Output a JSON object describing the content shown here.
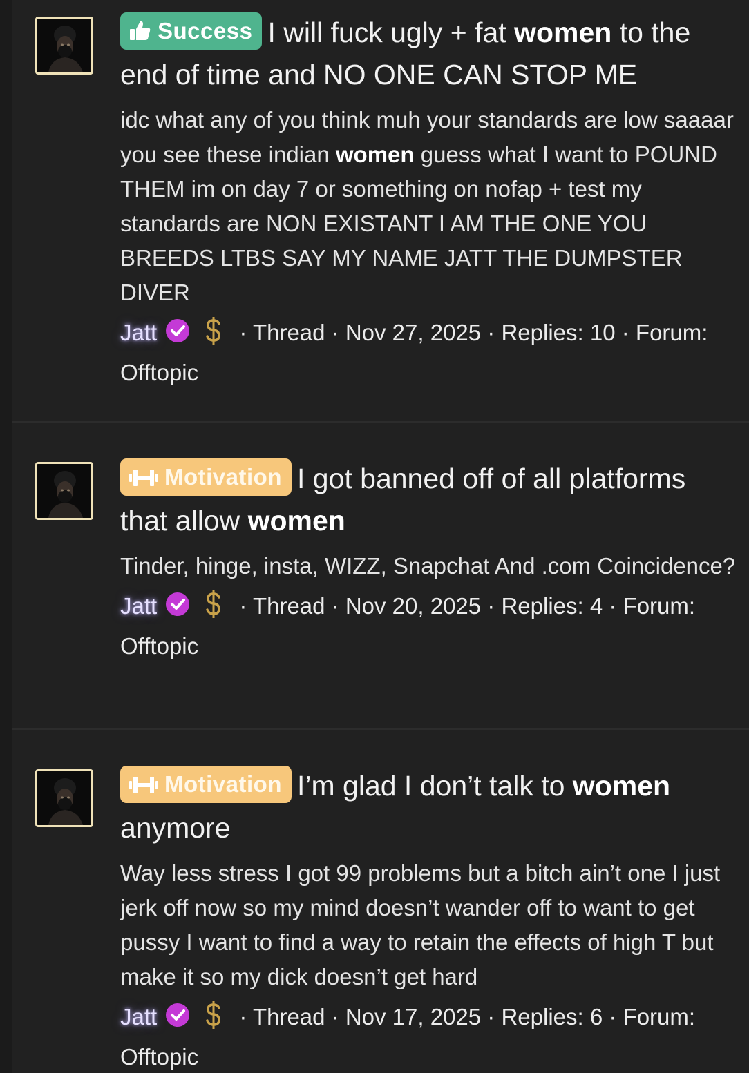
{
  "colors": {
    "background": "#212121",
    "success_prefix": "#4fb48e",
    "motivation_prefix": "#f7c77b",
    "verified_badge": "#c43ad6",
    "dollar_icon": "#c9a24a",
    "avatar_border": "#efe2b8"
  },
  "threads": [
    {
      "prefix": {
        "label": "Success",
        "icon": "thumbs-up-icon",
        "color": "#4fb48e"
      },
      "title_pre": "I will fuck ugly + fat ",
      "title_bold": "women",
      "title_post": " to the end of time and NO ONE CAN STOP ME",
      "snippet_pre": "idc what any of you think muh your standards are low saaaar you see these indian ",
      "snippet_bold": "women",
      "snippet_post": " guess what I want to POUND THEM im on day 7 or something on nofap + test my standards are NON EXISTANT I AM THE ONE YOU BREEDS LTBS SAY MY NAME JATT THE DUMPSTER DIVER",
      "author": "Jatt",
      "verified_icon": "verified-check-icon",
      "dollar_icon": "dollar-sign-icon",
      "type": "Thread",
      "date": "Nov 27, 2025",
      "replies": "Replies: 10",
      "forum": "Forum: Offtopic"
    },
    {
      "prefix": {
        "label": "Motivation",
        "icon": "dumbbell-icon",
        "color": "#f7c77b"
      },
      "title_pre": "I got banned off of all platforms that allow ",
      "title_bold": "women",
      "title_post": "",
      "snippet_pre": "Tinder, hinge, insta, WIZZ, Snapchat And .com Coincidence?",
      "snippet_bold": "",
      "snippet_post": "",
      "author": "Jatt",
      "verified_icon": "verified-check-icon",
      "dollar_icon": "dollar-sign-icon",
      "type": "Thread",
      "date": "Nov 20, 2025",
      "replies": "Replies: 4",
      "forum": "Forum: Offtopic"
    },
    {
      "prefix": {
        "label": "Motivation",
        "icon": "dumbbell-icon",
        "color": "#f7c77b"
      },
      "title_pre": "I’m glad I don’t talk to ",
      "title_bold": "women",
      "title_post": " anymore",
      "snippet_pre": "Way less stress I got 99 problems but a bitch ain’t one I just jerk off now so my mind doesn’t wander off to want to get pussy I want to find a way to retain the effects of high T but make it so my dick doesn’t get hard",
      "snippet_bold": "",
      "snippet_post": "",
      "author": "Jatt",
      "verified_icon": "verified-check-icon",
      "dollar_icon": "dollar-sign-icon",
      "type": "Thread",
      "date": "Nov 17, 2025",
      "replies": "Replies: 6",
      "forum": "Forum: Offtopic"
    }
  ]
}
